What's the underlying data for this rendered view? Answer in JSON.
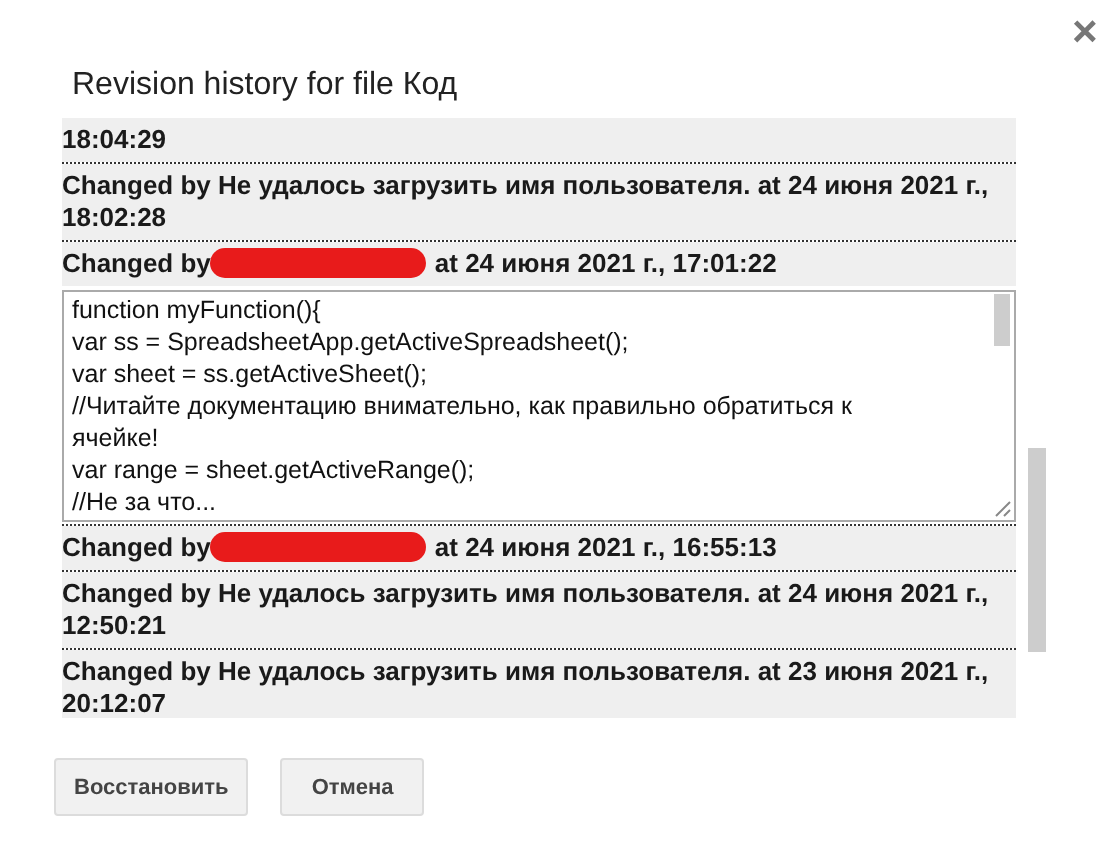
{
  "dialog": {
    "title": "Revision history for file Код",
    "close": "×"
  },
  "revisions": [
    {
      "kind": "plain",
      "text": "18:04:29",
      "expanded": false
    },
    {
      "kind": "plain",
      "text": "Changed by Не удалось загрузить имя пользователя. at 24 июня 2021 г., 18:02:28",
      "expanded": false
    },
    {
      "kind": "redacted",
      "before": "Changed by",
      "after": "at 24 июня 2021 г., 17:01:22",
      "expanded": true,
      "content": "function myFunction(){\nvar ss = SpreadsheetApp.getActiveSpreadsheet();\nvar sheet = ss.getActiveSheet();\n//Читайте документацию внимательно, как правильно обратиться к ячейке!\nvar range = sheet.getActiveRange();\n//Не за что..."
    },
    {
      "kind": "redacted",
      "before": "Changed by",
      "after": "at 24 июня 2021 г., 16:55:13",
      "expanded": false
    },
    {
      "kind": "plain",
      "text": "Changed by Не удалось загрузить имя пользователя. at 24 июня 2021 г., 12:50:21",
      "expanded": false
    },
    {
      "kind": "plain",
      "text": "Changed by Не удалось загрузить имя пользователя. at 23 июня 2021 г., 20:12:07",
      "expanded": false
    }
  ],
  "buttons": [
    {
      "label": "Восстановить"
    },
    {
      "label": "Отмена"
    }
  ]
}
